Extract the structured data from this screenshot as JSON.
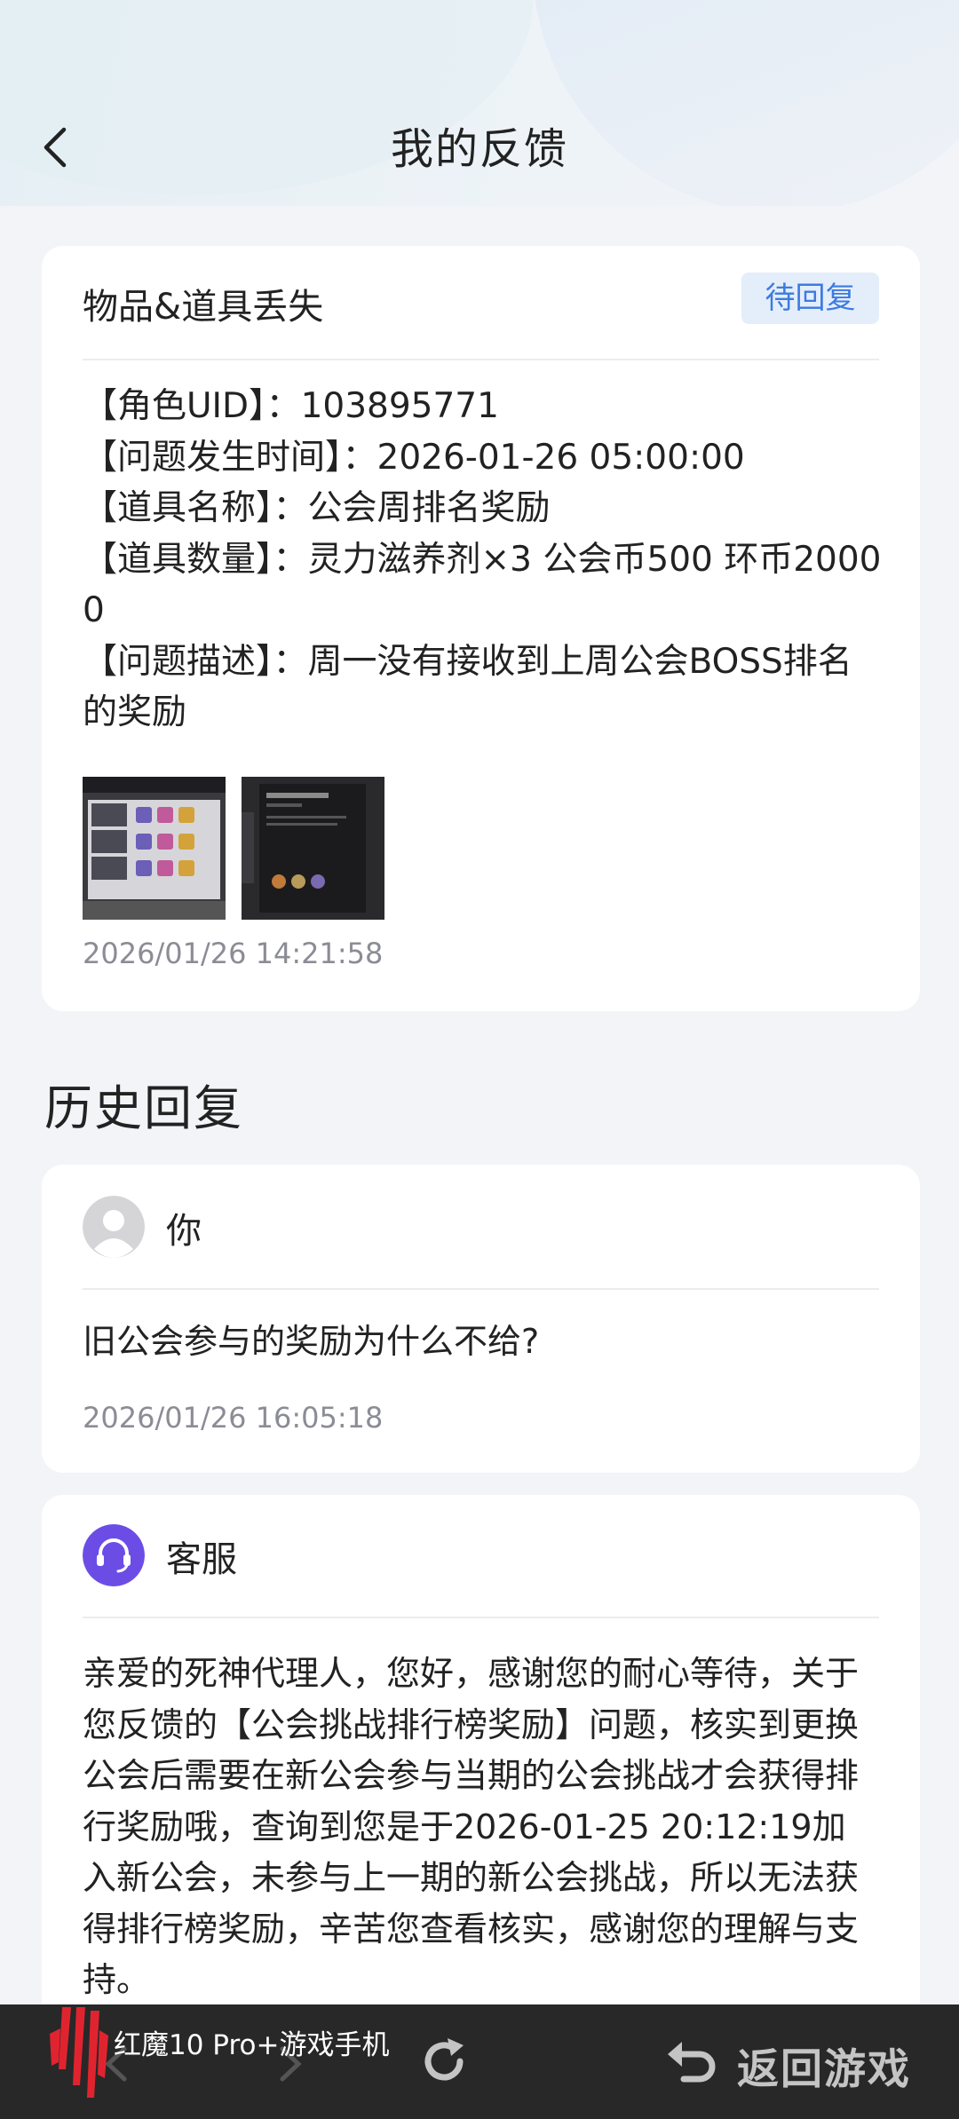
{
  "header": {
    "title": "我的反馈"
  },
  "feedback": {
    "category": "物品&道具丢失",
    "status": "待回复",
    "lines": [
      "【角色UID】：103895771",
      "【问题发生时间】：2026-01-26 05:00:00",
      "【道具名称】：公会周排名奖励",
      "【道具数量】：灵力滋养剂×3 公会币500 环币20000",
      "【问题描述】：周一没有接收到上周公会BOSS排名的奖励"
    ],
    "time": "2026/01/26 14:21:58"
  },
  "history": {
    "title": "历史回复",
    "replies": [
      {
        "author": "你",
        "text": "旧公会参与的奖励为什么不给?",
        "time": "2026/01/26 16:05:18"
      },
      {
        "author": "客服",
        "text": "亲爱的死神代理人，您好，感谢您的耐心等待，关于您反馈的【公会挑战排行榜奖励】问题，核实到更换公会后需要在新公会参与当期的公会挑战才会获得排行奖励哦，查询到您是于2026-01-25 20:12:19加入新公会，未参与上一期的新公会挑战，所以无法获得排行榜奖励，辛苦您查看核实，感谢您的理解与支持。"
      }
    ]
  },
  "bottom_bar": {
    "brand": "红魔10 Pro+游戏手机",
    "return_label": "返回游戏"
  },
  "colors": {
    "accent": "#3d7be0",
    "badge_bg": "#e4eefb",
    "support_avatar": "#6b4de6",
    "bar_bg": "#282828"
  }
}
